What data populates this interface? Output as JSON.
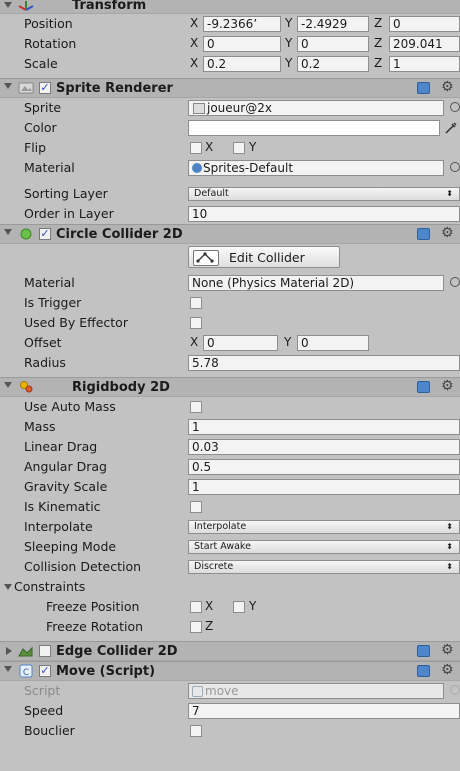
{
  "transform": {
    "title": "Transform",
    "position": {
      "label": "Position",
      "x": "-9.2366’",
      "y": "-2.4929",
      "z": "0"
    },
    "rotation": {
      "label": "Rotation",
      "x": "0",
      "y": "0",
      "z": "209.041"
    },
    "scale": {
      "label": "Scale",
      "x": "0.2",
      "y": "0.2",
      "z": "1"
    }
  },
  "axes": {
    "x": "X",
    "y": "Y",
    "z": "Z"
  },
  "sprite_renderer": {
    "title": "Sprite Renderer",
    "sprite": {
      "label": "Sprite",
      "value": "joueur@2x"
    },
    "color": {
      "label": "Color",
      "value": "#ffffff"
    },
    "flip": {
      "label": "Flip",
      "x": "X",
      "y": "Y"
    },
    "material": {
      "label": "Material",
      "value": "Sprites-Default"
    },
    "sorting_layer": {
      "label": "Sorting Layer",
      "value": "Default"
    },
    "order_in_layer": {
      "label": "Order in Layer",
      "value": "10"
    }
  },
  "circle_collider": {
    "title": "Circle Collider 2D",
    "edit_button": "Edit Collider",
    "material": {
      "label": "Material",
      "value": "None (Physics Material 2D)"
    },
    "is_trigger": {
      "label": "Is Trigger"
    },
    "used_by_effector": {
      "label": "Used By Effector"
    },
    "offset": {
      "label": "Offset",
      "x": "0",
      "y": "0"
    },
    "radius": {
      "label": "Radius",
      "value": "5.78"
    }
  },
  "rigidbody": {
    "title": "Rigidbody 2D",
    "use_auto_mass": {
      "label": "Use Auto Mass"
    },
    "mass": {
      "label": "Mass",
      "value": "1"
    },
    "linear_drag": {
      "label": "Linear Drag",
      "value": "0.03"
    },
    "angular_drag": {
      "label": "Angular Drag",
      "value": "0.5"
    },
    "gravity_scale": {
      "label": "Gravity Scale",
      "value": "1"
    },
    "is_kinematic": {
      "label": "Is Kinematic"
    },
    "interpolate": {
      "label": "Interpolate",
      "value": "Interpolate"
    },
    "sleeping_mode": {
      "label": "Sleeping Mode",
      "value": "Start Awake"
    },
    "collision_detection": {
      "label": "Collision Detection",
      "value": "Discrete"
    },
    "constraints": {
      "label": "Constraints"
    },
    "freeze_position": {
      "label": "Freeze Position",
      "x": "X",
      "y": "Y"
    },
    "freeze_rotation": {
      "label": "Freeze Rotation",
      "z": "Z"
    }
  },
  "edge_collider": {
    "title": "Edge Collider 2D"
  },
  "move_script": {
    "title": "Move (Script)",
    "script": {
      "label": "Script",
      "value": "move"
    },
    "speed": {
      "label": "Speed",
      "value": "7"
    },
    "bouclier": {
      "label": "Bouclier"
    }
  },
  "colors": {
    "background": "#c2c2c2",
    "header": "#b3b3b3",
    "help_icon": "#4f86c9",
    "check": "#2c4fbf"
  }
}
